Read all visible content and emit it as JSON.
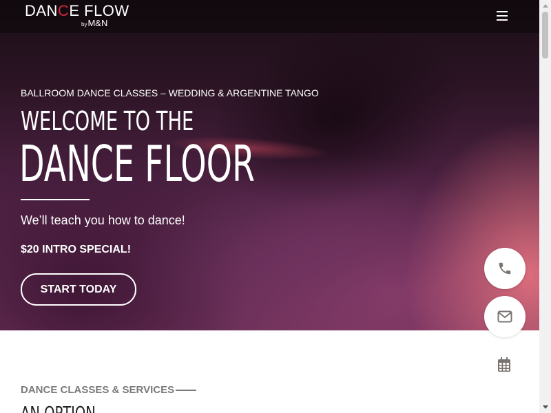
{
  "header": {
    "logo_main_pre": "DAN",
    "logo_main_accent": "C",
    "logo_main_post": "E FLOW",
    "logo_sub_by": "by",
    "logo_sub_name": "M&N"
  },
  "hero": {
    "eyebrow": "BALLROOM DANCE CLASSES – WEDDING & ARGENTINE TANGO",
    "title_line1": "WELCOME TO THE",
    "title_line2": "DANCE FLOOR",
    "tagline": "We’ll teach you how to dance!",
    "special": "$20 INTRO SPECIAL!",
    "cta_label": "START TODAY"
  },
  "section": {
    "eyebrow": "DANCE CLASSES & SERVICES",
    "heading": "AN OPTION"
  },
  "icons": {
    "menu": "hamburger-menu-icon",
    "phone": "phone-icon",
    "mail": "envelope-icon",
    "calendar": "calendar-icon"
  },
  "colors": {
    "accent": "#d8263a",
    "icon_gray": "#7a7470",
    "text_gray": "#7a7a7a"
  }
}
